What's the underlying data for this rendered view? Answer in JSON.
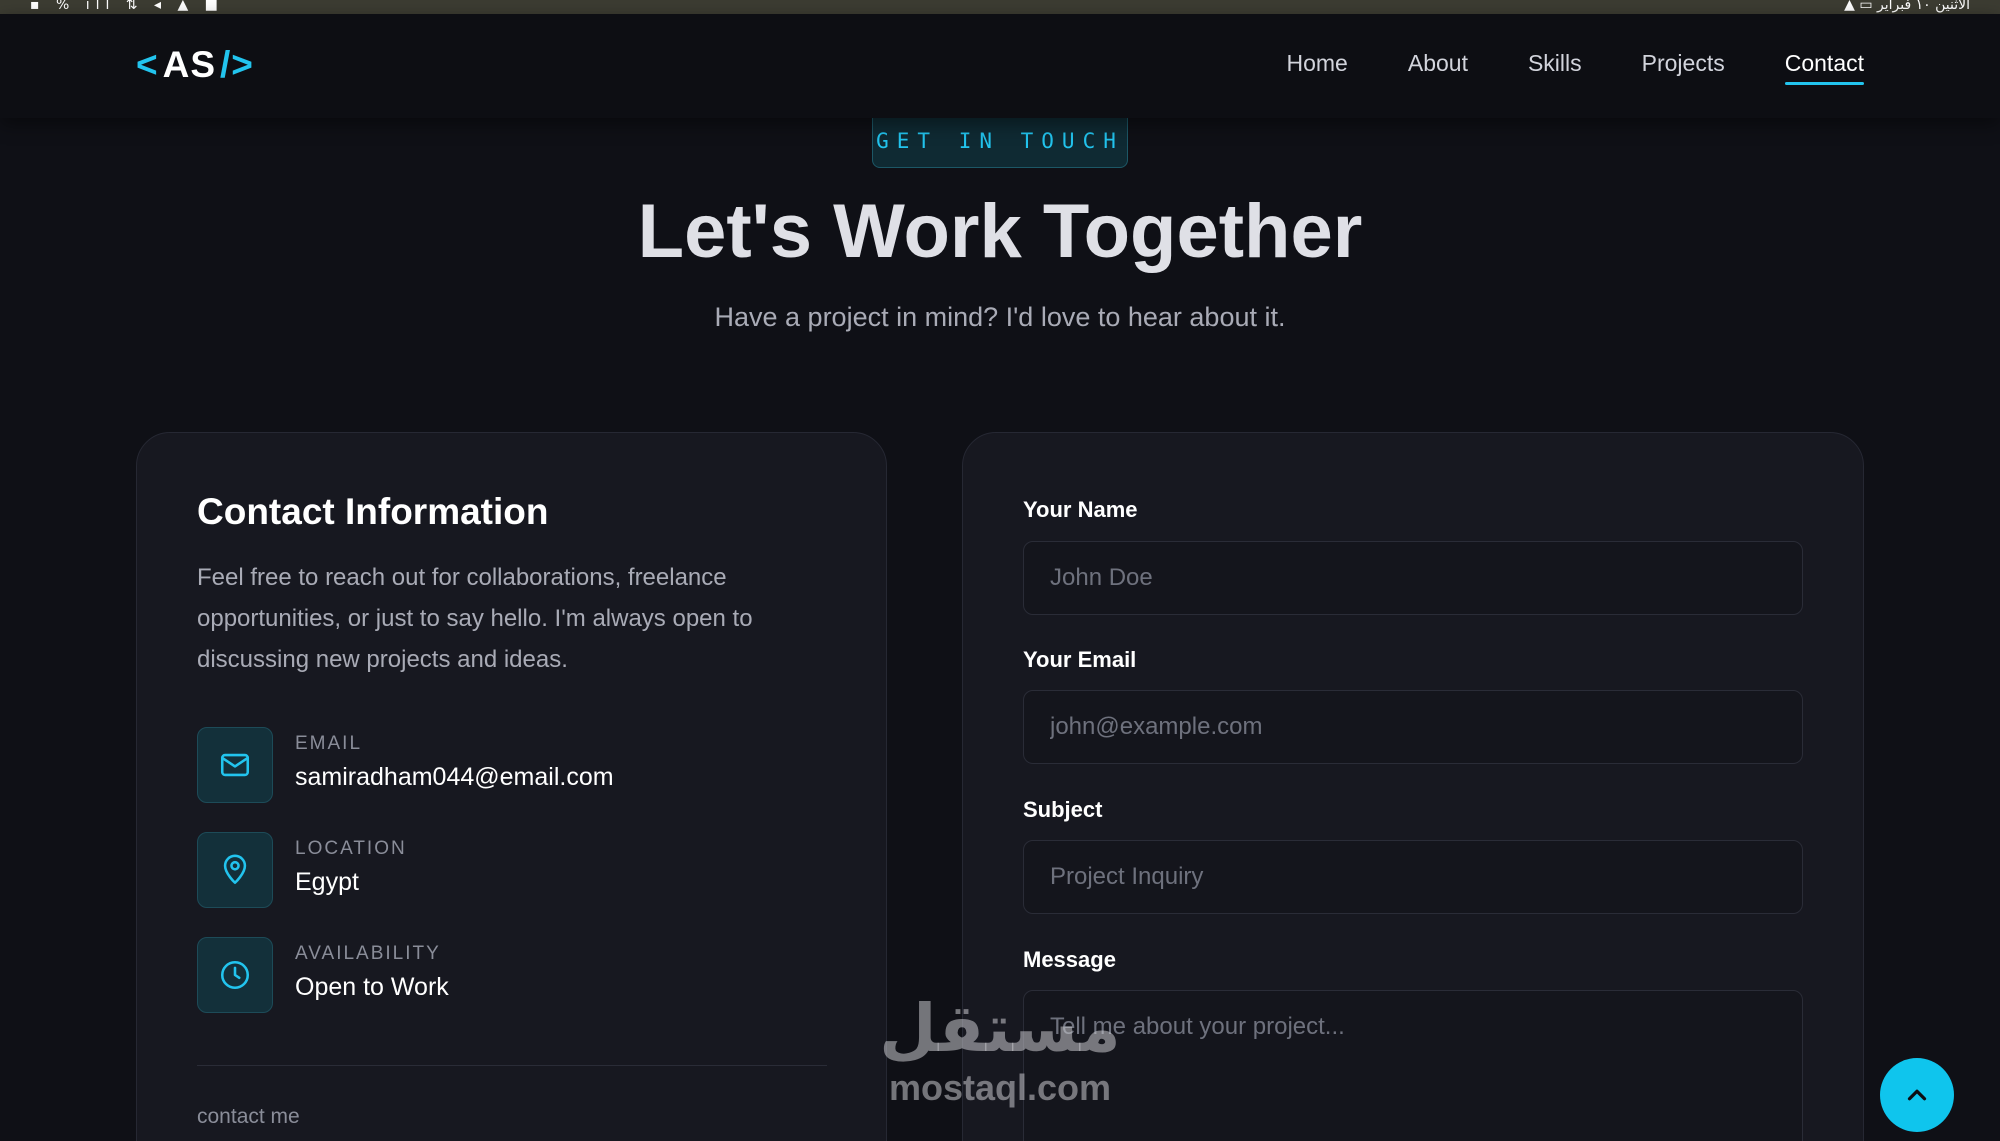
{
  "os_bar": {
    "left_glyphs": "▪ % ıll ⇅ ◂ ▲ ■",
    "right_glyphs": "▲ ▭ الاثنين ١٠ فبراير"
  },
  "nav": {
    "logo_open": "<",
    "logo_text": "AS",
    "logo_close": "/>",
    "links": [
      "Home",
      "About",
      "Skills",
      "Projects",
      "Contact"
    ],
    "active": "Contact"
  },
  "hero": {
    "badge": "GET IN TOUCH",
    "title": "Let's Work Together",
    "subtitle": "Have a project in mind? I'd love to hear about it."
  },
  "contact_info": {
    "title": "Contact Information",
    "description": "Feel free to reach out for collaborations, freelance opportunities, or just to say hello. I'm always open to discussing new projects and ideas.",
    "items": [
      {
        "icon": "mail-icon",
        "label": "EMAIL",
        "value": "samiradham044@email.com"
      },
      {
        "icon": "location-pin-icon",
        "label": "LOCATION",
        "value": "Egypt"
      },
      {
        "icon": "clock-icon",
        "label": "AVAILABILITY",
        "value": "Open to Work"
      }
    ],
    "footer_text": "contact me"
  },
  "form": {
    "name_label": "Your Name",
    "name_placeholder": "John Doe",
    "email_label": "Your Email",
    "email_placeholder": "john@example.com",
    "subject_label": "Subject",
    "subject_placeholder": "Project Inquiry",
    "message_label": "Message",
    "message_placeholder": "Tell me about your project..."
  },
  "watermark": {
    "arabic": "مستقل",
    "latin": "mostaql.com"
  },
  "colors": {
    "accent": "#22c4ee",
    "background": "#0f1016",
    "card": "#171820"
  }
}
